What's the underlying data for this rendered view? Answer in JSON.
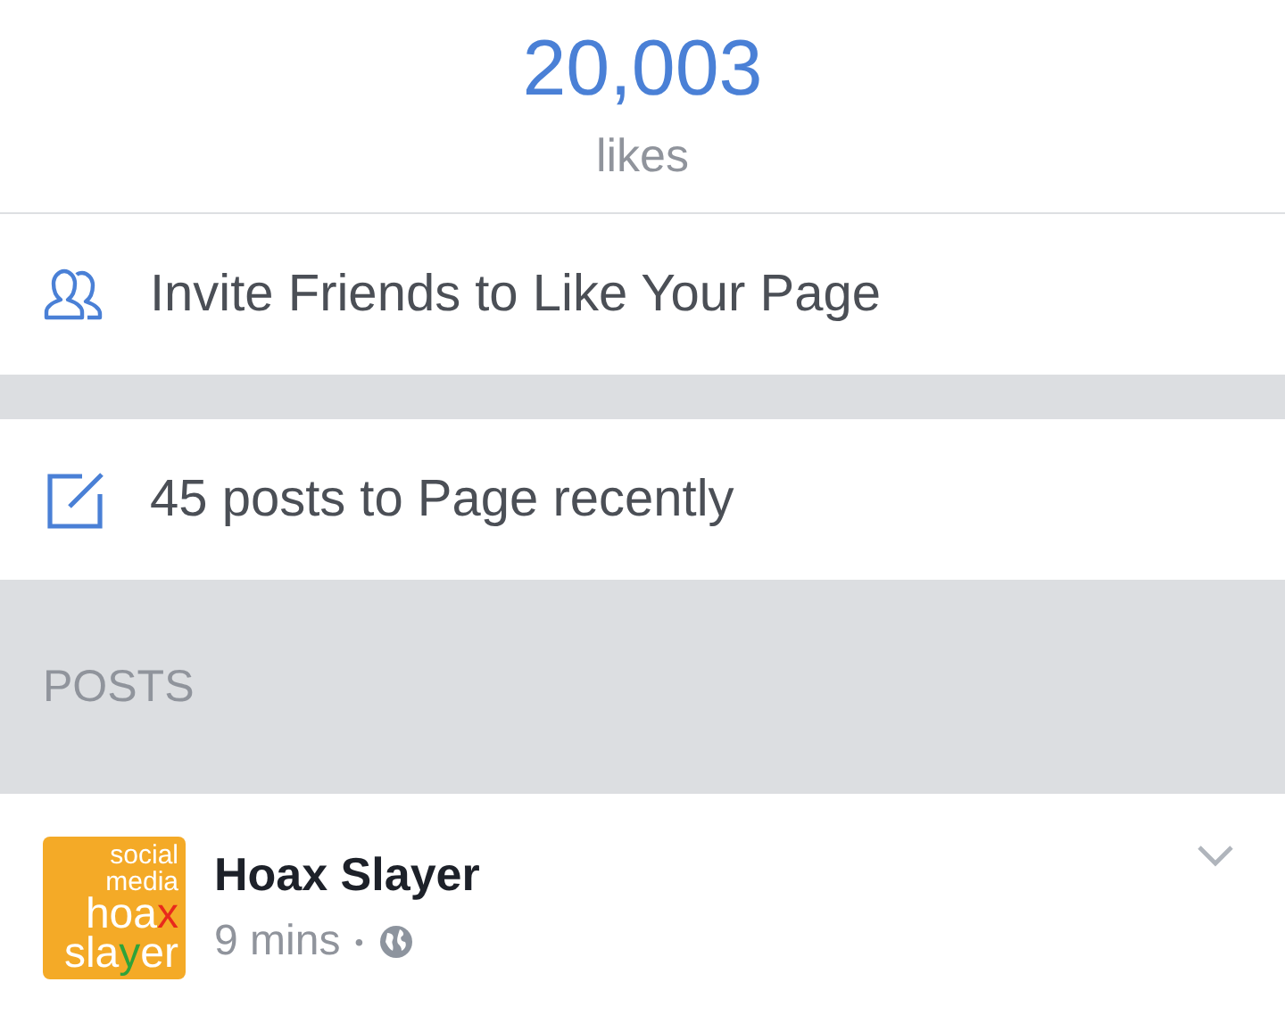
{
  "likes": {
    "count": "20,003",
    "label": "likes"
  },
  "invite": {
    "label": "Invite Friends to Like Your Page"
  },
  "recent_posts": {
    "label": "45 posts to Page recently"
  },
  "section_header": "POSTS",
  "post": {
    "avatar_lines": [
      [
        {
          "text": "social"
        }
      ],
      [
        {
          "text": "media"
        }
      ],
      [
        {
          "text": "hoa"
        },
        {
          "text": "x",
          "color": "#e8291c"
        }
      ],
      [
        {
          "text": "sla"
        },
        {
          "text": "y",
          "color": "#2fa33a"
        },
        {
          "text": "er"
        }
      ]
    ],
    "author": "Hoax Slayer",
    "time": "9 mins",
    "separator": "•"
  }
}
